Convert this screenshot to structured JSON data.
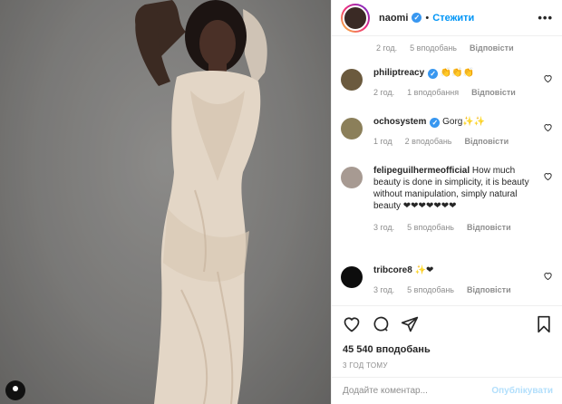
{
  "post": {
    "author": "naomi",
    "separator": "•",
    "follow_label": "Стежити",
    "more_label": "•••"
  },
  "comments": [
    {
      "user": "",
      "text": "",
      "time": "2 год.",
      "likes": "5 вподобань",
      "reply": "Відповісти"
    },
    {
      "user": "philiptreacy",
      "text": "👏👏👏",
      "time": "2 год.",
      "likes": "1 вподобання",
      "reply": "Відповісти"
    },
    {
      "user": "ochosystem",
      "text": "Gorg✨✨",
      "time": "1 год",
      "likes": "2 вподобань",
      "reply": "Відповісти"
    },
    {
      "user": "felipeguilhermeofficial",
      "text": "How much beauty is done in simplicity, it is beauty without manipulation, simply natural beauty ❤❤❤❤❤❤❤",
      "time": "3 год.",
      "likes": "5 вподобань",
      "reply": "Відповісти"
    },
    {
      "user": "tribcore8",
      "text": "✨❤",
      "time": "3 год.",
      "likes": "5 вподобань",
      "reply": "Відповісти"
    }
  ],
  "actions": {
    "likes_count": "45 540 вподобань",
    "time_ago": "3 ГОД ТОМУ"
  },
  "add_comment": {
    "placeholder": "Додайте коментар...",
    "publish_label": "Опублікувати"
  },
  "colors": {
    "accent": "#0095f6",
    "verified": "#3897f0",
    "muted": "#8e8e8e",
    "publish_disabled": "#b2dffc"
  }
}
